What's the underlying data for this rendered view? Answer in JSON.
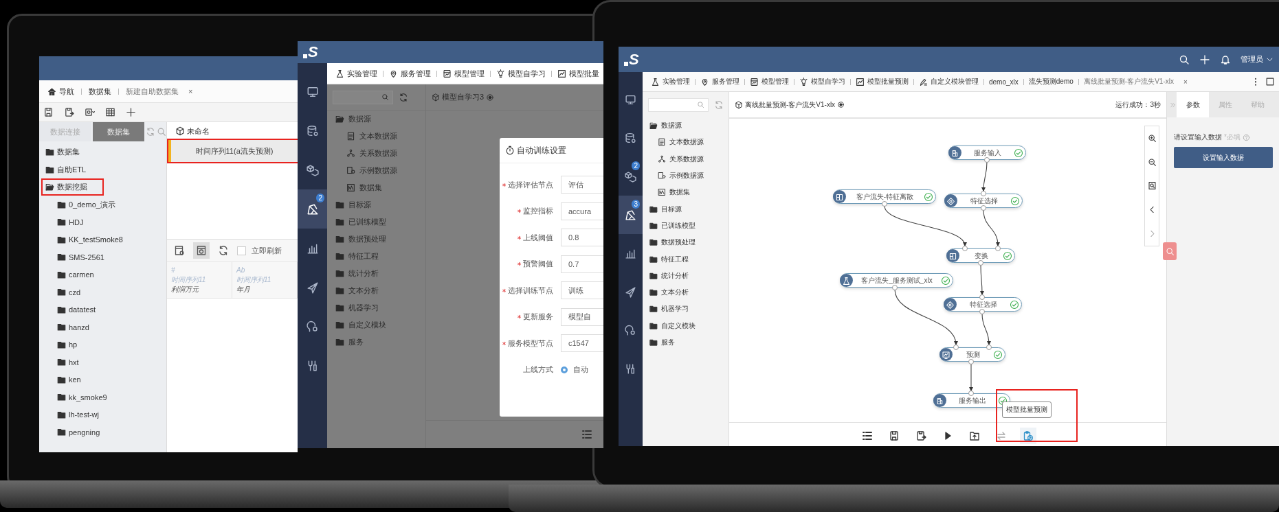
{
  "dataset_window": {
    "tabs": [
      {
        "label": "导航",
        "kind": "home"
      },
      {
        "label": "数据集",
        "kind": "plain"
      },
      {
        "label": "新建自助数据集",
        "kind": "plain",
        "close": "×"
      }
    ],
    "toolbar": [
      {
        "kind": "save"
      },
      {
        "kind": "saveas"
      },
      {
        "kind": "settingsmenu"
      },
      {
        "kind": "table"
      },
      {
        "kind": "add"
      }
    ],
    "panel_tabs": [
      {
        "label": "数据连接",
        "selected": false
      },
      {
        "label": "数据集",
        "selected": true
      }
    ],
    "tree": [
      {
        "label": "数据集",
        "expanded": false,
        "highlighted": false
      },
      {
        "label": "自助ETL",
        "expanded": false,
        "highlighted": false
      },
      {
        "label": "数据挖掘",
        "expanded": true,
        "highlighted": true,
        "children": [
          {
            "label": "0_demo_演示"
          },
          {
            "label": "HDJ"
          },
          {
            "label": "KK_testSmoke8"
          },
          {
            "label": "SMS-2561"
          },
          {
            "label": "carmen"
          },
          {
            "label": "czd"
          },
          {
            "label": "datatest"
          },
          {
            "label": "hanzd"
          },
          {
            "label": "hp"
          },
          {
            "label": "hxt"
          },
          {
            "label": "ken"
          },
          {
            "label": "kk_smoke9"
          },
          {
            "label": "lh-test-wj"
          },
          {
            "label": "pengning"
          }
        ]
      }
    ],
    "dataset_name": "未命名",
    "dataset_items": [
      {
        "label": "时间序列11(a流失预测)",
        "highlighted": true
      }
    ],
    "preview_tools": [
      {
        "kind": "addview",
        "selected": false
      },
      {
        "kind": "preview",
        "selected": true
      },
      {
        "kind": "refresh",
        "selected": false
      }
    ],
    "auto_refresh": {
      "label": "立即刷新",
      "checked": false
    },
    "columns": [
      {
        "type_mark": "#",
        "source": "时间序列11",
        "name": "利润万元"
      },
      {
        "type_mark": "Ab",
        "source": "时间序列11",
        "name": "年月"
      }
    ]
  },
  "self_learning_window": {
    "logo": "S",
    "rail": [
      {
        "kind": "monitor",
        "selected": false
      },
      {
        "kind": "database",
        "selected": false
      },
      {
        "kind": "cubes",
        "selected": false
      },
      {
        "kind": "model",
        "selected": true,
        "badge": "2"
      },
      {
        "kind": "chart",
        "selected": false
      },
      {
        "kind": "send",
        "selected": false
      },
      {
        "kind": "brain",
        "selected": false
      },
      {
        "kind": "tools",
        "selected": false
      }
    ],
    "nav": [
      {
        "label": "实验管理",
        "kind": "flask"
      },
      {
        "label": "服务管理",
        "kind": "service"
      },
      {
        "label": "模型管理",
        "kind": "modelmgr"
      },
      {
        "label": "模型自学习",
        "kind": "bulb"
      },
      {
        "label": "模型批量",
        "kind": "linechart"
      }
    ],
    "tree": [
      {
        "label": "数据源",
        "expanded": true,
        "children": [
          {
            "label": "文本数据源",
            "kind": "textfile"
          },
          {
            "label": "关系数据源",
            "kind": "relation"
          },
          {
            "label": "示例数据源",
            "kind": "sample"
          },
          {
            "label": "数据集",
            "kind": "dataset"
          }
        ]
      },
      {
        "label": "目标源",
        "expanded": false
      },
      {
        "label": "已训练模型",
        "expanded": false
      },
      {
        "label": "数据预处理",
        "expanded": false
      },
      {
        "label": "特征工程",
        "expanded": false
      },
      {
        "label": "统计分析",
        "expanded": false
      },
      {
        "label": "文本分析",
        "expanded": false
      },
      {
        "label": "机器学习",
        "expanded": false
      },
      {
        "label": "自定义模块",
        "expanded": false
      },
      {
        "label": "服务",
        "expanded": false
      }
    ],
    "canvas_title": "模型自学习3",
    "dialog": {
      "title": "自动训练设置",
      "fields": [
        {
          "label": "选择评估节点",
          "required": true,
          "value": "评估"
        },
        {
          "label": "监控指标",
          "required": true,
          "value": "accura"
        },
        {
          "label": "上线阈值",
          "required": true,
          "value": "0.8"
        },
        {
          "label": "预警阈值",
          "required": true,
          "value": "0.7"
        },
        {
          "label": "选择训练节点",
          "required": true,
          "value": "训练"
        },
        {
          "label": "更新服务",
          "required": true,
          "value": "模型自"
        },
        {
          "label": "服务模型节点",
          "required": true,
          "value": "c1547"
        }
      ],
      "online_mode": {
        "label": "上线方式",
        "options": [
          {
            "label": "自动",
            "selected": true
          }
        ]
      }
    },
    "bottom_tools": [
      {
        "kind": "list"
      }
    ]
  },
  "batch_window": {
    "logo": "S",
    "user": "管理员",
    "rail": [
      {
        "kind": "monitor",
        "selected": false
      },
      {
        "kind": "database",
        "selected": false
      },
      {
        "kind": "cubes",
        "selected": false,
        "badge": "2"
      },
      {
        "kind": "model",
        "selected": true,
        "badge": "3"
      },
      {
        "kind": "chart",
        "selected": false
      },
      {
        "kind": "send",
        "selected": false
      },
      {
        "kind": "brain",
        "selected": false
      },
      {
        "kind": "tools",
        "selected": false
      }
    ],
    "nav": [
      {
        "label": "实验管理",
        "kind": "flask"
      },
      {
        "label": "服务管理",
        "kind": "service"
      },
      {
        "label": "模型管理",
        "kind": "modelmgr"
      },
      {
        "label": "模型自学习",
        "kind": "bulb"
      },
      {
        "label": "模型批量预测",
        "kind": "linechart"
      },
      {
        "label": "自定义模块管理",
        "kind": "pencil"
      },
      {
        "label": "demo_xlx",
        "kind": "plain"
      },
      {
        "label": "流失预测demo",
        "kind": "plain"
      },
      {
        "label": "离线批量预测-客户流失V1-xlx",
        "kind": "plain",
        "close": "×"
      }
    ],
    "tree": [
      {
        "label": "数据源",
        "expanded": true,
        "children": [
          {
            "label": "文本数据源",
            "kind": "textfile"
          },
          {
            "label": "关系数据源",
            "kind": "relation"
          },
          {
            "label": "示例数据源",
            "kind": "sample"
          },
          {
            "label": "数据集",
            "kind": "dataset"
          }
        ]
      },
      {
        "label": "目标源",
        "expanded": false
      },
      {
        "label": "已训练模型",
        "expanded": false
      },
      {
        "label": "数据预处理",
        "expanded": false
      },
      {
        "label": "特征工程",
        "expanded": false
      },
      {
        "label": "统计分析",
        "expanded": false
      },
      {
        "label": "文本分析",
        "expanded": false
      },
      {
        "label": "机器学习",
        "expanded": false
      },
      {
        "label": "自定义模块",
        "expanded": false
      },
      {
        "label": "服务",
        "expanded": false
      }
    ],
    "canvas_title": "离线批量预测-客户流失V1-xlx",
    "run_status": "运行成功：3秒",
    "nodes": [
      {
        "label": "服务输入",
        "kind": "io",
        "done": true
      },
      {
        "label": "特征选择",
        "kind": "feature",
        "done": true
      },
      {
        "label": "客户流失-特征离散",
        "kind": "grid",
        "done": true
      },
      {
        "label": "变换",
        "kind": "grid",
        "done": true
      },
      {
        "label": "客户流失_服务测试_xlx",
        "kind": "flask",
        "done": true
      },
      {
        "label": "特征选择",
        "kind": "feature",
        "done": true
      },
      {
        "label": "预测",
        "kind": "predict",
        "done": true
      },
      {
        "label": "服务输出",
        "kind": "io",
        "done": true
      }
    ],
    "canvas_tools": [
      {
        "kind": "zoomin",
        "disabled": false
      },
      {
        "kind": "zoomout",
        "disabled": false
      },
      {
        "kind": "fit",
        "disabled": false
      },
      {
        "kind": "prev",
        "disabled": false
      },
      {
        "kind": "next",
        "disabled": true
      }
    ],
    "bottom_tools": [
      {
        "kind": "list",
        "disabled": false,
        "highlighted": false
      },
      {
        "kind": "save",
        "disabled": false,
        "highlighted": false
      },
      {
        "kind": "saveas",
        "disabled": false,
        "highlighted": false
      },
      {
        "kind": "play",
        "disabled": false,
        "highlighted": false
      },
      {
        "kind": "import",
        "disabled": false,
        "highlighted": false
      },
      {
        "kind": "swap",
        "disabled": true,
        "highlighted": false
      },
      {
        "kind": "batch",
        "disabled": false,
        "highlighted": true,
        "tooltip": "模型批量预测"
      }
    ],
    "panel_tabs": [
      {
        "label": "参数",
        "selected": true
      },
      {
        "label": "属性",
        "selected": false
      },
      {
        "label": "帮助",
        "selected": false
      }
    ],
    "input_label": "请设置输入数据",
    "required_note": "*必填",
    "input_button": "设置输入数据"
  }
}
